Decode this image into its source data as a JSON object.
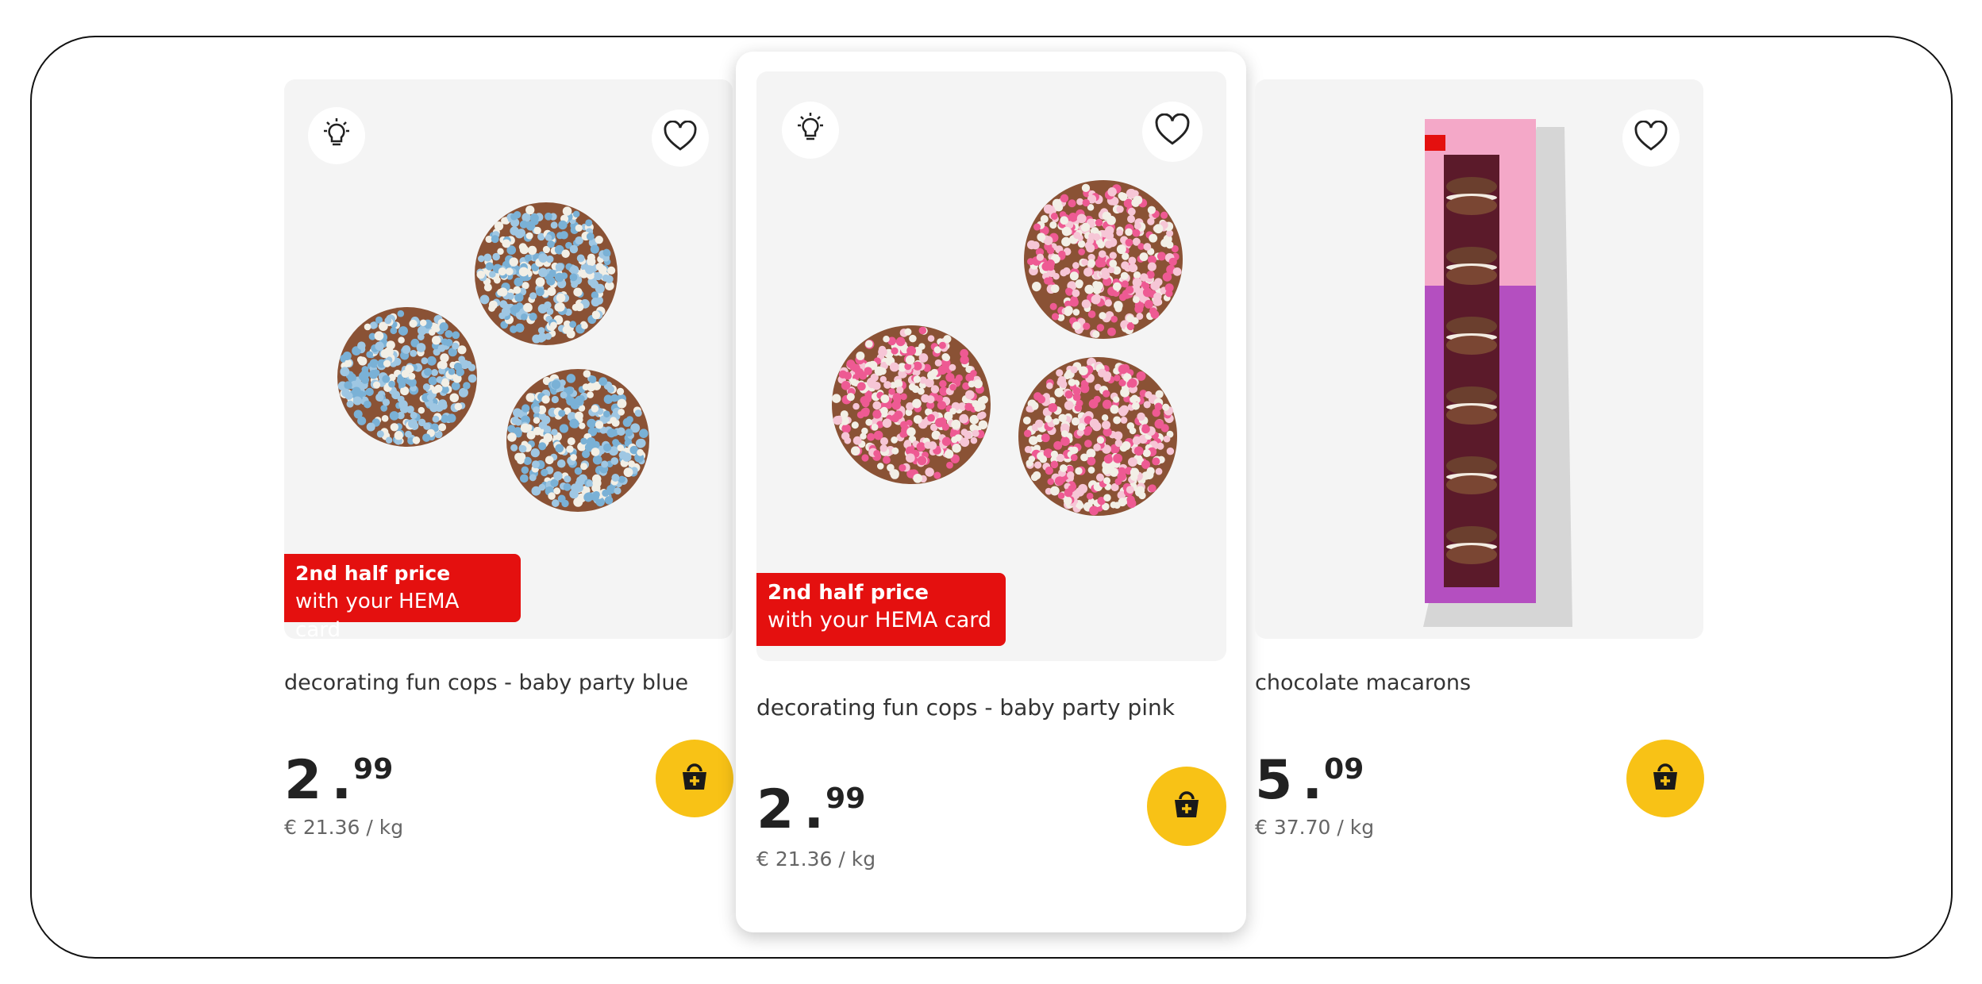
{
  "products": [
    {
      "title": "decorating fun cops - baby party blue",
      "price_euros": "2",
      "price_cents": "99",
      "unit_price": "€ 21.36 / kg",
      "promo_line1": "2nd half price",
      "promo_line2": "with your HEMA card",
      "dot_colors": [
        "#9fc7e3",
        "#f2efe6",
        "#7ab1d6"
      ],
      "base_color": "#8a5235"
    },
    {
      "title": "decorating fun cops - baby party pink",
      "price_euros": "2",
      "price_cents": "99",
      "unit_price": "€ 21.36 / kg",
      "promo_line1": "2nd half price",
      "promo_line2": "with your HEMA card",
      "dot_colors": [
        "#ee5a93",
        "#f6c6d6",
        "#f2efe6"
      ],
      "base_color": "#8a5235"
    },
    {
      "title": "chocolate macarons",
      "price_euros": "5",
      "price_cents": "09",
      "unit_price": "€ 37.70 / kg"
    }
  ],
  "colors": {
    "promo_red": "#e4100f",
    "basket_yellow": "#f8c216",
    "image_bg": "#f4f4f4"
  },
  "icons": [
    "lightbulb-icon",
    "heart-icon",
    "basket-add-icon"
  ]
}
